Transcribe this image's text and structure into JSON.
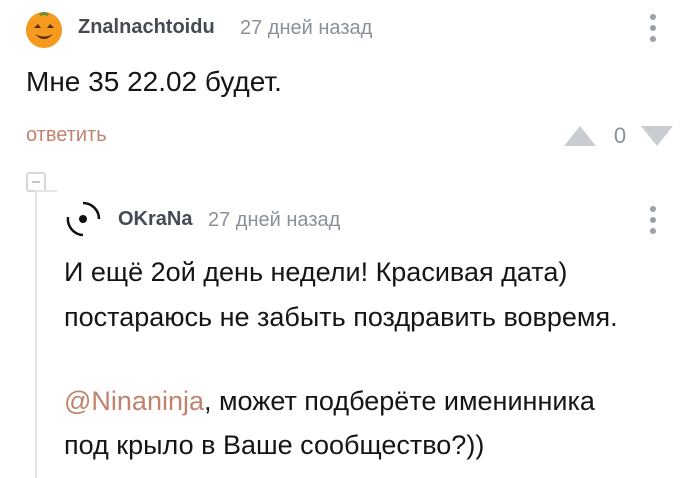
{
  "top_comment": {
    "username": "Znalnachtoidu",
    "time": "27 дней назад",
    "text": "Мне 35 22.02 будет.",
    "reply_label": "ответить",
    "rating": "0"
  },
  "reply_comment": {
    "username": "OKraNa",
    "time": "27 дней назад",
    "line1": "И ещё 2ой день недели! Красивая дата)",
    "line2": "постараюсь не забыть поздравить вовремя.",
    "mention": "@Ninaninja",
    "line4_rest": ", может подберёте именинника",
    "line5": "под крыло в Ваше сообщество?))"
  },
  "colors": {
    "accent": "#c1836d",
    "meta_text": "#8a9099",
    "vote_arrow": "#c9ccd1",
    "avatar_orange": "#f59a1f"
  },
  "icons": {
    "avatar1": "smiling-pumpkin-avatar",
    "avatar2": "circle-logo-avatar",
    "menu": "more-vertical-icon",
    "upvote": "triangle-up-icon",
    "downvote": "triangle-down-icon",
    "collapse": "minus-box-icon"
  }
}
